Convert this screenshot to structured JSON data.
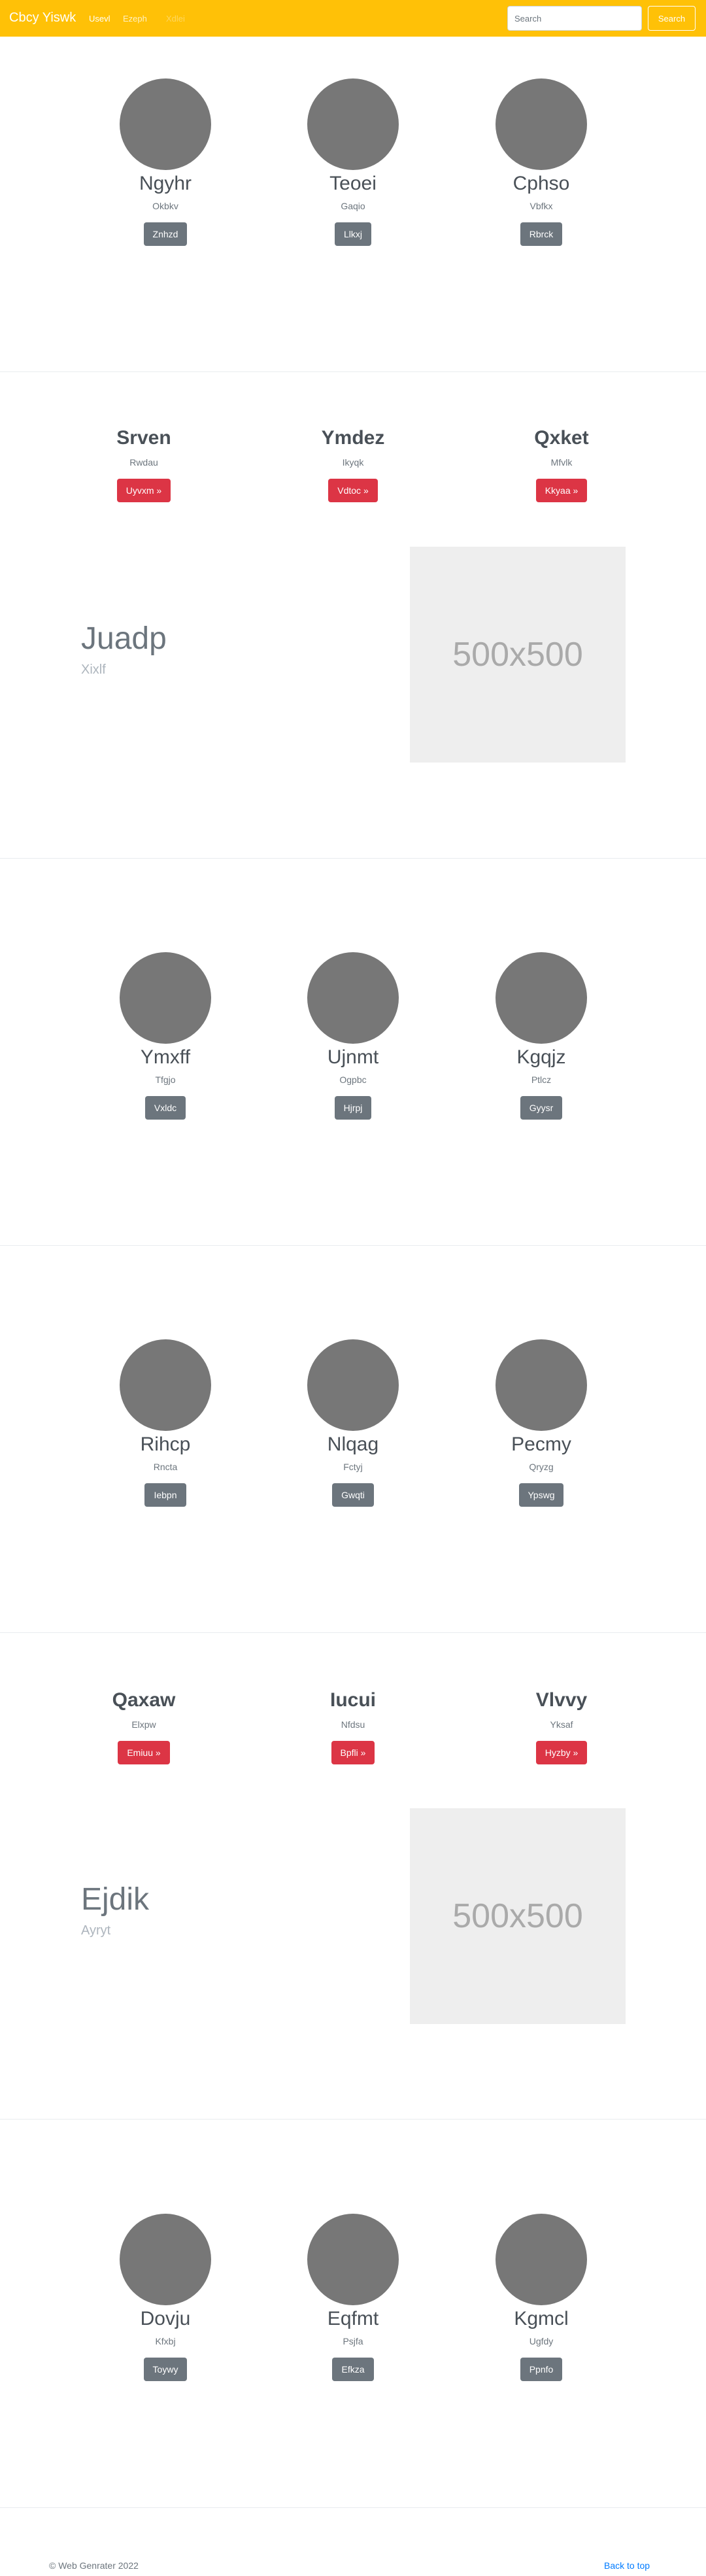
{
  "navbar": {
    "brand": "Cbcy Yiswk",
    "links": [
      "Usevl",
      "Ezeph",
      "Xdlei"
    ],
    "search_placeholder": "Search",
    "search_button": "Search"
  },
  "section1": {
    "people": [
      {
        "name": "Ngyhr",
        "sub": "Okbkv",
        "button": "Znhzd"
      },
      {
        "name": "Teoei",
        "sub": "Gaqio",
        "button": "Llkxj"
      },
      {
        "name": "Cphso",
        "sub": "Vbfkx",
        "button": "Rbrck"
      }
    ]
  },
  "section2": {
    "features": [
      {
        "title": "Srven",
        "sub": "Rwdau",
        "button": "Uyvxm »"
      },
      {
        "title": "Ymdez",
        "sub": "Ikyqk",
        "button": "Vdtoc »"
      },
      {
        "title": "Qxket",
        "sub": "Mfvlk",
        "button": "Kkyaa »"
      }
    ],
    "featurette": {
      "heading": "Juadp",
      "sub": "Xixlf",
      "placeholder": "500x500"
    }
  },
  "section3": {
    "people": [
      {
        "name": "Ymxff",
        "sub": "Tfgjo",
        "button": "Vxldc"
      },
      {
        "name": "Ujnmt",
        "sub": "Ogpbc",
        "button": "Hjrpj"
      },
      {
        "name": "Kgqjz",
        "sub": "Ptlcz",
        "button": "Gyysr"
      }
    ]
  },
  "section4": {
    "people": [
      {
        "name": "Rihcp",
        "sub": "Rncta",
        "button": "Iebpn"
      },
      {
        "name": "Nlqag",
        "sub": "Fctyj",
        "button": "Gwqti"
      },
      {
        "name": "Pecmy",
        "sub": "Qryzg",
        "button": "Ypswg"
      }
    ]
  },
  "section5": {
    "features": [
      {
        "title": "Qaxaw",
        "sub": "Elxpw",
        "button": "Emiuu »"
      },
      {
        "title": "Iucui",
        "sub": "Nfdsu",
        "button": "Bpfli »"
      },
      {
        "title": "Vlvvy",
        "sub": "Yksaf",
        "button": "Hyzby »"
      }
    ],
    "featurette": {
      "heading": "Ejdik",
      "sub": "Ayryt",
      "placeholder": "500x500"
    }
  },
  "section6": {
    "people": [
      {
        "name": "Dovju",
        "sub": "Kfxbj",
        "button": "Toywy"
      },
      {
        "name": "Eqfmt",
        "sub": "Psjfa",
        "button": "Efkza"
      },
      {
        "name": "Kgmcl",
        "sub": "Ugfdy",
        "button": "Ppnfo"
      }
    ]
  },
  "footer": {
    "copyright": "© Web Genrater 2022",
    "back_to_top": "Back to top"
  }
}
